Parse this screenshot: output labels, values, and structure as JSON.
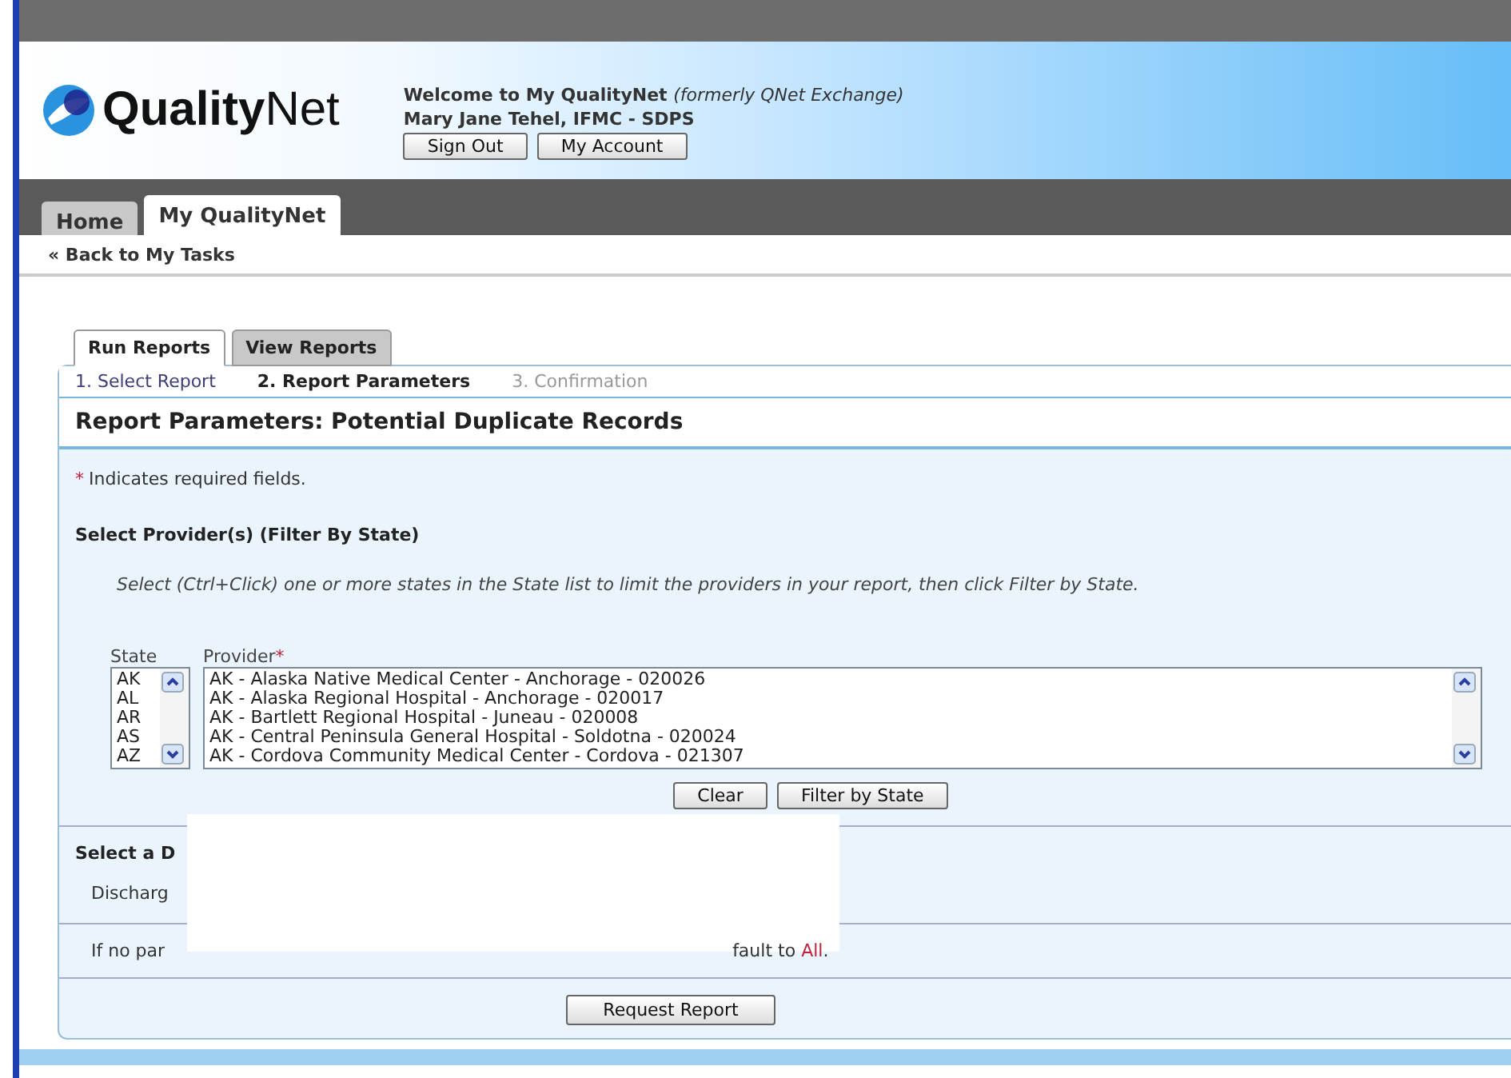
{
  "header": {
    "logo": "QualityNet",
    "welcome": "Welcome to My QualityNet",
    "welcome_note": "(formerly QNet Exchange)",
    "user": "Mary Jane Tehel, IFMC - SDPS",
    "buttons": [
      "Sign Out",
      "My Account"
    ]
  },
  "nav_tabs": [
    {
      "label": "Home",
      "selected": false
    },
    {
      "label": "My QualityNet",
      "selected": true
    }
  ],
  "back_link": "« Back to My Tasks",
  "report_tabs": [
    {
      "label": "Run Reports",
      "selected": true
    },
    {
      "label": "View Reports",
      "selected": false
    }
  ],
  "steps": [
    {
      "label": "1. Select Report",
      "selected": false,
      "disabled": false
    },
    {
      "label": "2. Report Parameters",
      "selected": true,
      "disabled": false
    },
    {
      "label": "3. Confirmation",
      "selected": false,
      "disabled": true
    }
  ],
  "title": "Report Parameters: Potential Duplicate Records",
  "required_mark": "*",
  "required_note": "Indicates required fields.",
  "provider_section": {
    "heading": "Select Provider(s) (Filter By State)",
    "instructions": "Select (Ctrl+Click) one or more states in the State list to limit the providers in your report, then click Filter by State.",
    "state_label": "State",
    "states": [
      "AK",
      "AL",
      "AR",
      "AS",
      "AZ"
    ],
    "provider_label": "Provider",
    "providers": [
      "AK - Alaska Native Medical Center - Anchorage - 020026",
      "AK - Alaska Regional Hospital - Anchorage - 020017",
      "AK - Bartlett Regional Hospital - Juneau - 020008",
      "AK - Central Peninsula General Hospital - Soldotna - 020024",
      "AK - Cordova Community Medical Center - Cordova - 021307"
    ],
    "buttons": [
      "Clear",
      "Filter by State"
    ]
  },
  "date_section": {
    "heading": "Select a D",
    "field_label": "Discharg"
  },
  "note": {
    "before": "If no par",
    "tail": "fault to ",
    "highlight": "All",
    "after": "."
  },
  "submit": "Request Report"
}
